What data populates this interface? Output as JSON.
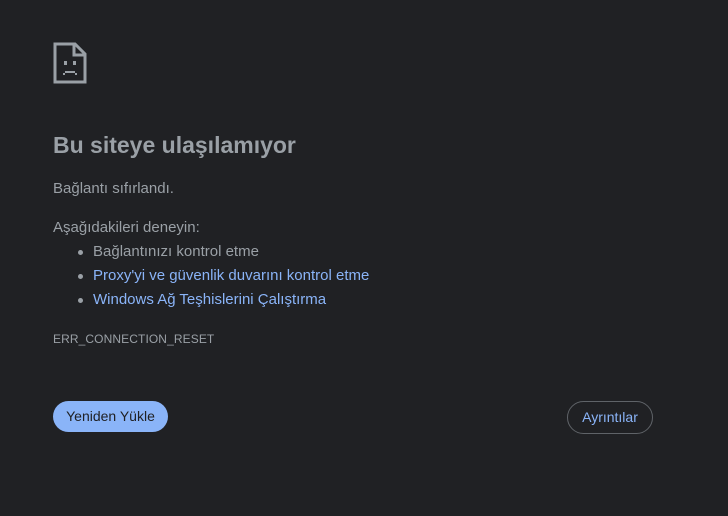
{
  "error_page": {
    "icon": "sad-document-icon",
    "title": "Bu siteye ulaşılamıyor",
    "summary": "Bağlantı sıfırlandı.",
    "try_header": "Aşağıdakileri deneyin:",
    "suggestions": [
      {
        "label": "Bağlantınızı kontrol etme",
        "is_link": false
      },
      {
        "label": "Proxy'yi ve güvenlik duvarını kontrol etme",
        "is_link": true
      },
      {
        "label": "Windows Ağ Teşhislerini Çalıştırma",
        "is_link": true
      }
    ],
    "error_code": "ERR_CONNECTION_RESET",
    "reload_button": "Yeniden Yükle",
    "details_button": "Ayrıntılar"
  },
  "colors": {
    "background": "#202124",
    "text": "#9aa0a6",
    "link": "#8ab4f8",
    "button_bg": "#8ab4f8",
    "button_border": "#5f6368"
  }
}
